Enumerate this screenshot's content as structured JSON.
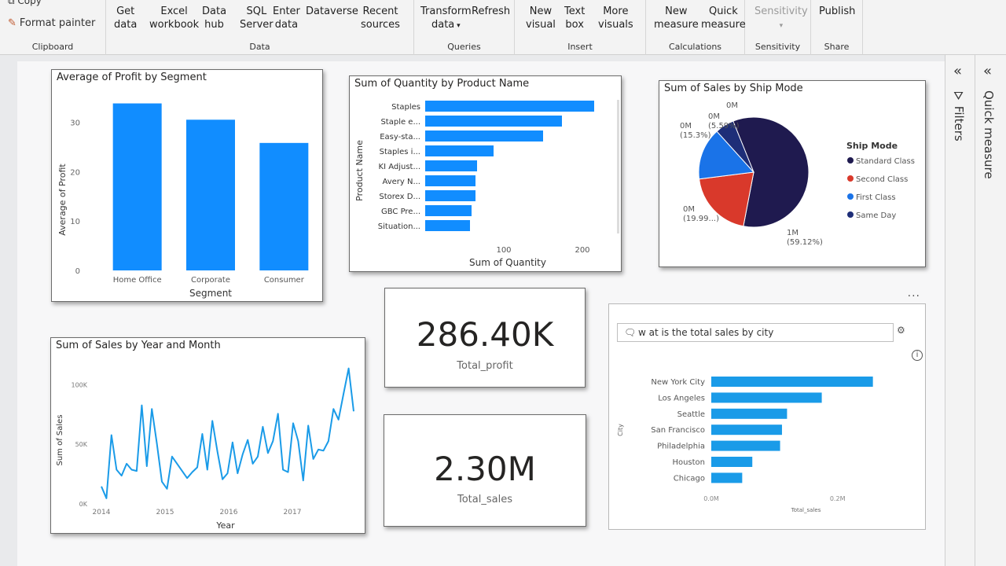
{
  "ribbon": {
    "clipboard": {
      "copy": "Copy",
      "format_painter": "Format painter",
      "group": "Clipboard"
    },
    "data": {
      "group": "Data",
      "buttons": [
        {
          "l1": "Get",
          "l2": "data"
        },
        {
          "l1": "Excel",
          "l2": "workbook"
        },
        {
          "l1": "Data",
          "l2": "hub"
        },
        {
          "l1": "SQL",
          "l2": "Server"
        },
        {
          "l1": "Enter",
          "l2": "data"
        },
        {
          "l1": "Dataverse",
          "l2": ""
        },
        {
          "l1": "Recent",
          "l2": "sources"
        }
      ]
    },
    "queries": {
      "group": "Queries",
      "transform": {
        "l1": "Transform",
        "l2": "data"
      },
      "refresh": "Refresh"
    },
    "insert": {
      "group": "Insert",
      "buttons": [
        {
          "l1": "New",
          "l2": "visual"
        },
        {
          "l1": "Text",
          "l2": "box"
        },
        {
          "l1": "More",
          "l2": "visuals"
        }
      ]
    },
    "calculations": {
      "group": "Calculations",
      "buttons": [
        {
          "l1": "New",
          "l2": "measure"
        },
        {
          "l1": "Quick",
          "l2": "measure"
        }
      ]
    },
    "sensitivity": {
      "group": "Sensitivity",
      "button": "Sensitivity"
    },
    "share": {
      "group": "Share",
      "button": "Publish"
    }
  },
  "panes": {
    "filters": "Filters",
    "quick_measure": "Quick measure"
  },
  "visuals": {
    "profit_by_segment": {
      "title": "Average of Profit by Segment",
      "chart_data": {
        "type": "bar",
        "categories": [
          "Home Office",
          "Corporate",
          "Consumer"
        ],
        "values": [
          33.8,
          30.5,
          25.8
        ],
        "xlabel": "Segment",
        "ylabel": "Average of Profit",
        "ylim": [
          0,
          35
        ],
        "yticks": [
          "0",
          "10",
          "20",
          "30"
        ],
        "color": "#118DFF"
      }
    },
    "quantity_by_product": {
      "title": "Sum of Quantity by Product Name",
      "chart_data": {
        "type": "bar",
        "orientation": "horizontal",
        "categories": [
          "Staples",
          "Staple e...",
          "Easy-sta...",
          "Staples i...",
          "KI Adjust...",
          "Avery N...",
          "Storex D...",
          "GBC Pre...",
          "Situation..."
        ],
        "values": [
          215,
          174,
          150,
          87,
          66,
          64,
          64,
          59,
          57
        ],
        "xlabel": "Sum of Quantity",
        "ylabel": "Product Name",
        "xticks": [
          "100",
          "200"
        ],
        "color": "#118DFF"
      }
    },
    "sales_by_ship_mode": {
      "title": "Sum of Sales by Ship Mode",
      "chart_data": {
        "type": "pie",
        "legend_title": "Ship Mode",
        "legend_position": "right",
        "slices": [
          {
            "name": "Standard Class",
            "share": 59.12,
            "label": "1M",
            "pct": "(59.12%)",
            "color": "#1F1A4F"
          },
          {
            "name": "Second Class",
            "share": 19.99,
            "label": "0M",
            "pct": "(19.99...)",
            "color": "#D9392B"
          },
          {
            "name": "First Class",
            "share": 15.3,
            "label": "0M",
            "pct": "(15.3%)",
            "color": "#1A73E8"
          },
          {
            "name": "Same Day",
            "share": 5.59,
            "label": "0M",
            "pct": "(5.59%)",
            "color": "#1E2E78"
          }
        ],
        "extra_label": "0M"
      }
    },
    "total_profit": {
      "value": "286.40K",
      "label": "Total_profit"
    },
    "total_sales": {
      "value": "2.30M",
      "label": "Total_sales"
    },
    "sales_by_year_month": {
      "title": "Sum of Sales by Year and Month",
      "chart_data": {
        "type": "line",
        "xlabel": "Year",
        "ylabel": "Sum of Sales",
        "xticks": [
          "2014",
          "2015",
          "2016",
          "2017"
        ],
        "yticks": [
          "0K",
          "50K",
          "100K"
        ],
        "ylim": [
          0,
          120000
        ],
        "color": "#1A9BE8",
        "values": [
          14000,
          4000,
          57000,
          28000,
          23000,
          33000,
          28000,
          27000,
          82000,
          31000,
          79000,
          50000,
          18000,
          12000,
          39000,
          33000,
          27000,
          21000,
          26000,
          30000,
          58000,
          28000,
          69000,
          43000,
          20000,
          25000,
          51000,
          25000,
          41000,
          53000,
          33000,
          39000,
          64000,
          42000,
          52000,
          75000,
          28000,
          26000,
          67000,
          52000,
          19000,
          65000,
          37000,
          45000,
          44000,
          52000,
          79000,
          70000,
          92000,
          113000,
          77000
        ]
      }
    },
    "qa": {
      "question": "w at is the total sales by city",
      "chart_data": {
        "type": "bar",
        "orientation": "horizontal",
        "categories": [
          "New York City",
          "Los Angeles",
          "Seattle",
          "San Francisco",
          "Philadelphia",
          "Houston",
          "Chicago"
        ],
        "values": [
          0.256,
          0.175,
          0.12,
          0.112,
          0.109,
          0.065,
          0.049
        ],
        "xlabel": "Total_sales",
        "ylabel": "City",
        "xticks": [
          "0.0M",
          "0.2M"
        ],
        "color": "#1A9BE8"
      },
      "more_options": "..."
    }
  }
}
